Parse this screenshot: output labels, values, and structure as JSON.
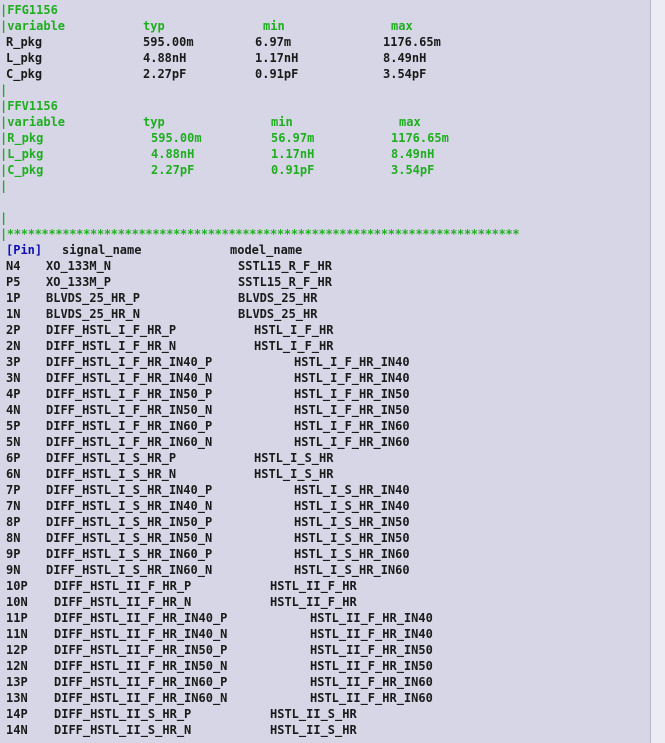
{
  "ffg": {
    "header": "|FFG1156",
    "labels": [
      "|variable",
      "typ",
      "min",
      "max"
    ],
    "rows": [
      [
        "R_pkg",
        "595.00m",
        "6.97m",
        "1176.65m"
      ],
      [
        "L_pkg",
        "4.88nH",
        "1.17nH",
        "8.49nH"
      ],
      [
        "C_pkg",
        "2.27pF",
        "0.91pF",
        "3.54pF"
      ]
    ],
    "bar_after": "|"
  },
  "ffv": {
    "header": "|FFV1156",
    "labels": [
      "|variable",
      "typ",
      "min",
      "max"
    ],
    "rows": [
      [
        "|R_pkg",
        "595.00m",
        "56.97m",
        "1176.65m"
      ],
      [
        "|L_pkg",
        "4.88nH",
        "1.17nH",
        "8.49nH"
      ],
      [
        "|C_pkg",
        "2.27pF",
        "0.91pF",
        "3.54pF"
      ]
    ],
    "bar_after": "|"
  },
  "separator": {
    "bar": "|",
    "stars": "|**************************************************************************"
  },
  "pin_header": {
    "tag": "[Pin]",
    "signal": "signal_name",
    "model": "model_name"
  },
  "pins": [
    [
      "N4",
      "XO_133M_N",
      "SSTL15_R_F_HR"
    ],
    [
      "P5",
      "XO_133M_P",
      "SSTL15_R_F_HR"
    ],
    [
      "1P",
      "BLVDS_25_HR_P",
      "BLVDS_25_HR"
    ],
    [
      "1N",
      "BLVDS_25_HR_N",
      "BLVDS_25_HR"
    ],
    [
      "2P",
      "DIFF_HSTL_I_F_HR_P",
      "HSTL_I_F_HR"
    ],
    [
      "2N",
      "DIFF_HSTL_I_F_HR_N",
      "HSTL_I_F_HR"
    ],
    [
      "3P",
      "DIFF_HSTL_I_F_HR_IN40_P",
      "HSTL_I_F_HR_IN40"
    ],
    [
      "3N",
      "DIFF_HSTL_I_F_HR_IN40_N",
      "HSTL_I_F_HR_IN40"
    ],
    [
      "4P",
      "DIFF_HSTL_I_F_HR_IN50_P",
      "HSTL_I_F_HR_IN50"
    ],
    [
      "4N",
      "DIFF_HSTL_I_F_HR_IN50_N",
      "HSTL_I_F_HR_IN50"
    ],
    [
      "5P",
      "DIFF_HSTL_I_F_HR_IN60_P",
      "HSTL_I_F_HR_IN60"
    ],
    [
      "5N",
      "DIFF_HSTL_I_F_HR_IN60_N",
      "HSTL_I_F_HR_IN60"
    ],
    [
      "6P",
      "DIFF_HSTL_I_S_HR_P",
      "HSTL_I_S_HR"
    ],
    [
      "6N",
      "DIFF_HSTL_I_S_HR_N",
      "HSTL_I_S_HR"
    ],
    [
      "7P",
      "DIFF_HSTL_I_S_HR_IN40_P",
      "HSTL_I_S_HR_IN40"
    ],
    [
      "7N",
      "DIFF_HSTL_I_S_HR_IN40_N",
      "HSTL_I_S_HR_IN40"
    ],
    [
      "8P",
      "DIFF_HSTL_I_S_HR_IN50_P",
      "HSTL_I_S_HR_IN50"
    ],
    [
      "8N",
      "DIFF_HSTL_I_S_HR_IN50_N",
      "HSTL_I_S_HR_IN50"
    ],
    [
      "9P",
      "DIFF_HSTL_I_S_HR_IN60_P",
      "HSTL_I_S_HR_IN60"
    ],
    [
      "9N",
      "DIFF_HSTL_I_S_HR_IN60_N",
      "HSTL_I_S_HR_IN60"
    ],
    [
      "10P",
      "DIFF_HSTL_II_F_HR_P",
      "HSTL_II_F_HR"
    ],
    [
      "10N",
      "DIFF_HSTL_II_F_HR_N",
      "HSTL_II_F_HR"
    ],
    [
      "11P",
      "DIFF_HSTL_II_F_HR_IN40_P",
      "HSTL_II_F_HR_IN40"
    ],
    [
      "11N",
      "DIFF_HSTL_II_F_HR_IN40_N",
      "HSTL_II_F_HR_IN40"
    ],
    [
      "12P",
      "DIFF_HSTL_II_F_HR_IN50_P",
      "HSTL_II_F_HR_IN50"
    ],
    [
      "12N",
      "DIFF_HSTL_II_F_HR_IN50_N",
      "HSTL_II_F_HR_IN50"
    ],
    [
      "13P",
      "DIFF_HSTL_II_F_HR_IN60_P",
      "HSTL_II_F_HR_IN60"
    ],
    [
      "13N",
      "DIFF_HSTL_II_F_HR_IN60_N",
      "HSTL_II_F_HR_IN60"
    ],
    [
      "14P",
      "DIFF_HSTL_II_S_HR_P",
      "HSTL_II_S_HR"
    ],
    [
      "14N",
      "DIFF_HSTL_II_S_HR_N",
      "HSTL_II_S_HR"
    ]
  ]
}
